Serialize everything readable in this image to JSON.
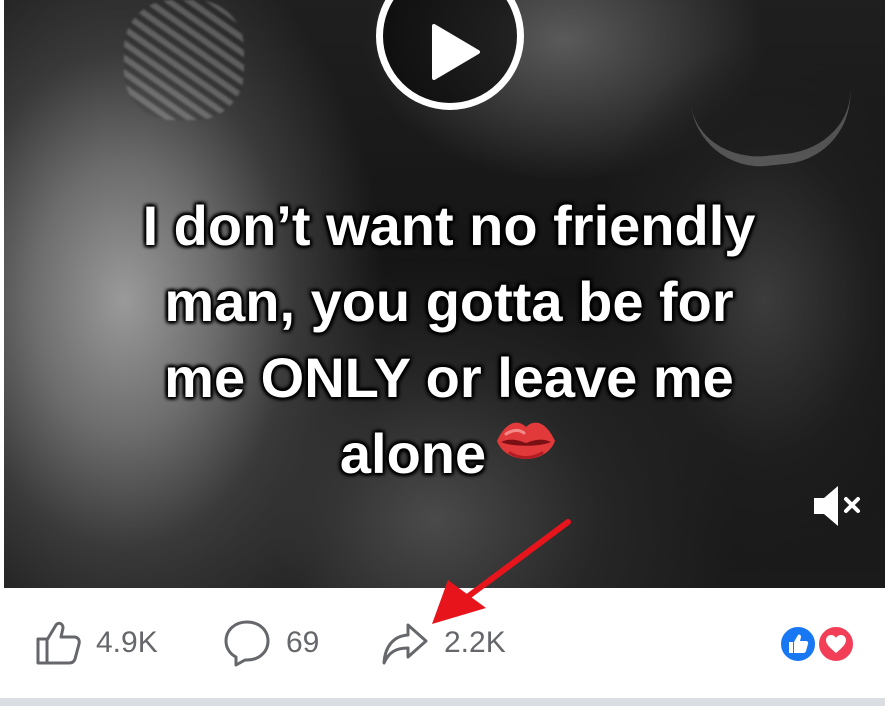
{
  "video": {
    "caption_line1": "I don’t want no friendly",
    "caption_line2": "man, you gotta be for",
    "caption_line3": "me ONLY or leave me",
    "caption_line4": "alone",
    "caption_emoji": "lips-kiss-emoji",
    "play_icon": "play-icon",
    "mute_icon": "speaker-muted-icon"
  },
  "actions": {
    "like_count": "4.9K",
    "comment_count": "69",
    "share_count": "2.2K",
    "like_icon": "thumbs-up-icon",
    "comment_icon": "comment-bubble-icon",
    "share_icon": "share-arrow-icon"
  },
  "reactions": [
    "like",
    "love"
  ],
  "annotation": {
    "type": "red-arrow",
    "color": "#e8141c",
    "points_to": "share-action"
  },
  "colors": {
    "count_text": "#65676b",
    "like_blue": "#1877f2",
    "love_red": "#f33e58"
  }
}
